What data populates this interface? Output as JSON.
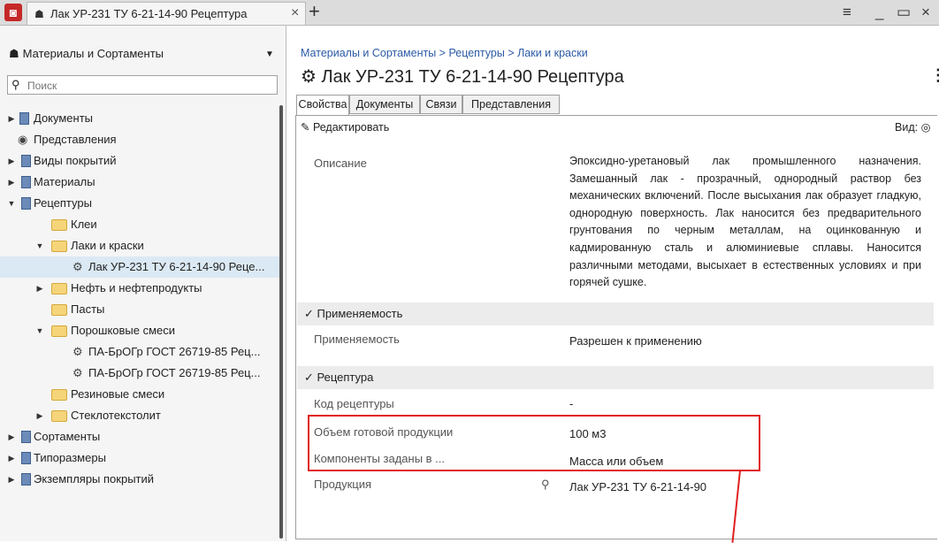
{
  "window": {
    "app_logo_icon": "app-logo-icon",
    "tab_title": "Лак УР-231 ТУ 6-21-14-90 Рецептура",
    "tab_close": "×",
    "add_tab": "+",
    "menu": "≡",
    "minimize": "_",
    "maximize": "▭",
    "close": "×"
  },
  "sidebar": {
    "title": "Материалы и Сортаменты",
    "search_placeholder": "Поиск",
    "items": [
      {
        "label": "Документы"
      },
      {
        "label": "Представления"
      },
      {
        "label": "Виды покрытий"
      },
      {
        "label": "Материалы"
      },
      {
        "label": "Рецептуры"
      },
      {
        "label": "Клеи"
      },
      {
        "label": "Лаки и краски"
      },
      {
        "label": "Лак УР-231 ТУ 6-21-14-90 Реце..."
      },
      {
        "label": "Нефть и нефтепродукты"
      },
      {
        "label": "Пасты"
      },
      {
        "label": "Порошковые смеси"
      },
      {
        "label": "ПА-БрОГр ГОСТ 26719-85 Рец..."
      },
      {
        "label": "ПА-БрОГр ГОСТ 26719-85 Рец..."
      },
      {
        "label": "Резиновые смеси"
      },
      {
        "label": "Стеклотекстолит"
      },
      {
        "label": "Сортаменты"
      },
      {
        "label": "Типоразмеры"
      },
      {
        "label": "Экземпляры покрытий"
      }
    ]
  },
  "main": {
    "breadcrumb": "Материалы и Сортаменты > Рецептуры > Лаки и краски",
    "title": "Лак УР-231 ТУ 6-21-14-90 Рецептура",
    "tabs": [
      {
        "label": "Свойства"
      },
      {
        "label": "Документы"
      },
      {
        "label": "Связи"
      },
      {
        "label": "Представления"
      }
    ],
    "toolbar": {
      "edit_label": "Редактировать",
      "view_label": "Вид:"
    },
    "description": {
      "label": "Описание",
      "value": "Эпоксидно-уретановый лак промышленного назначения. Замешанный лак - прозрачный, однородный раствор без механических включений. После высыхания лак образует гладкую, однородную поверхность. Лак наносится без предварительного грунтования по черным металлам, на оцинкованную и кадмированную сталь и алюминиевые сплавы. Наносится различными методами, высыхает в естественных условиях и при горячей сушке."
    },
    "applicability_section": "Применяемость",
    "applicability": {
      "label": "Применяемость",
      "value": "Разрешен к применению"
    },
    "recipe_section": "Рецептура",
    "recipe_code": {
      "label": "Код рецептуры",
      "value": "-"
    },
    "volume": {
      "label": "Объем готовой продукции",
      "value": "100  м3"
    },
    "components": {
      "label": "Компоненты заданы в ...",
      "value": "Масса или объем"
    },
    "product": {
      "label": "Продукция",
      "value": "Лак УР-231 ТУ 6-21-14-90"
    }
  },
  "colors": {
    "highlight": "#e02020",
    "breadcrumb": "#2b5aa5",
    "selected_row": "#dbe9f4"
  }
}
